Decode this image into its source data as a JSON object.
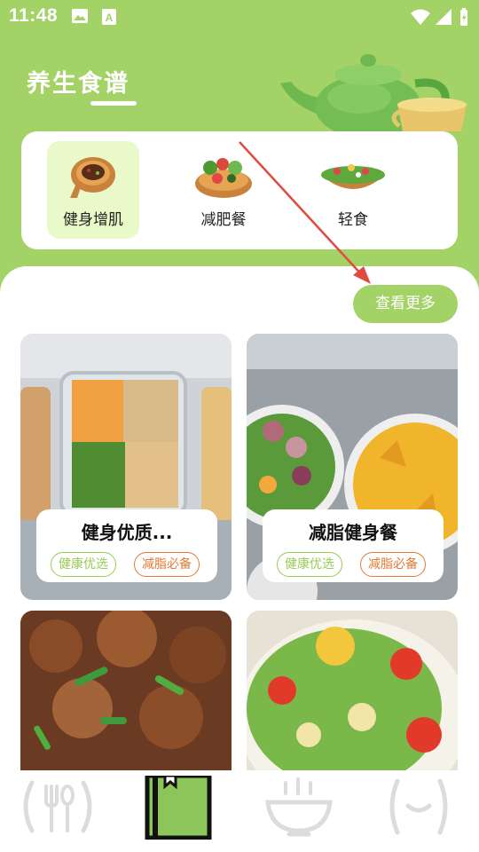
{
  "status_bar": {
    "time": "11:48",
    "icons": [
      "image-icon",
      "font-a-icon",
      "wifi-icon",
      "signal-icon",
      "battery-charging-icon"
    ]
  },
  "header": {
    "title": "养生食谱",
    "decoration": "teapot-illustration"
  },
  "categories": [
    {
      "label": "健身增肌",
      "icon": "steak-plate-icon",
      "active": true
    },
    {
      "label": "减肥餐",
      "icon": "veggie-platter-icon",
      "active": false
    },
    {
      "label": "轻食",
      "icon": "salad-bowl-icon",
      "active": false
    }
  ],
  "see_more_label": "查看更多",
  "recipes": [
    {
      "title": "健身优质...",
      "tags": [
        "健康优选",
        "减脂必备"
      ],
      "image": "meal-prep-boxes-photo"
    },
    {
      "title": "减脂健身餐",
      "tags": [
        "健康优选",
        "减脂必备"
      ],
      "image": "mango-veggie-bowl-photo"
    },
    {
      "title": "",
      "tags": [],
      "image": "spicy-chicken-scallion-photo"
    },
    {
      "title": "",
      "tags": [],
      "image": "fresh-salad-photo"
    }
  ],
  "bottom_nav": [
    {
      "icon": "fork-spoon-icon",
      "active": false
    },
    {
      "icon": "bookmark-book-icon",
      "active": true
    },
    {
      "icon": "bowl-icon",
      "active": false
    },
    {
      "icon": "face-icon",
      "active": false
    }
  ],
  "colors": {
    "brand_green": "#a3d267",
    "active_category_bg": "#eaf9c9",
    "tag_green": "#9acb55",
    "tag_orange": "#e07a35",
    "annotation_arrow": "#e04a3f"
  }
}
